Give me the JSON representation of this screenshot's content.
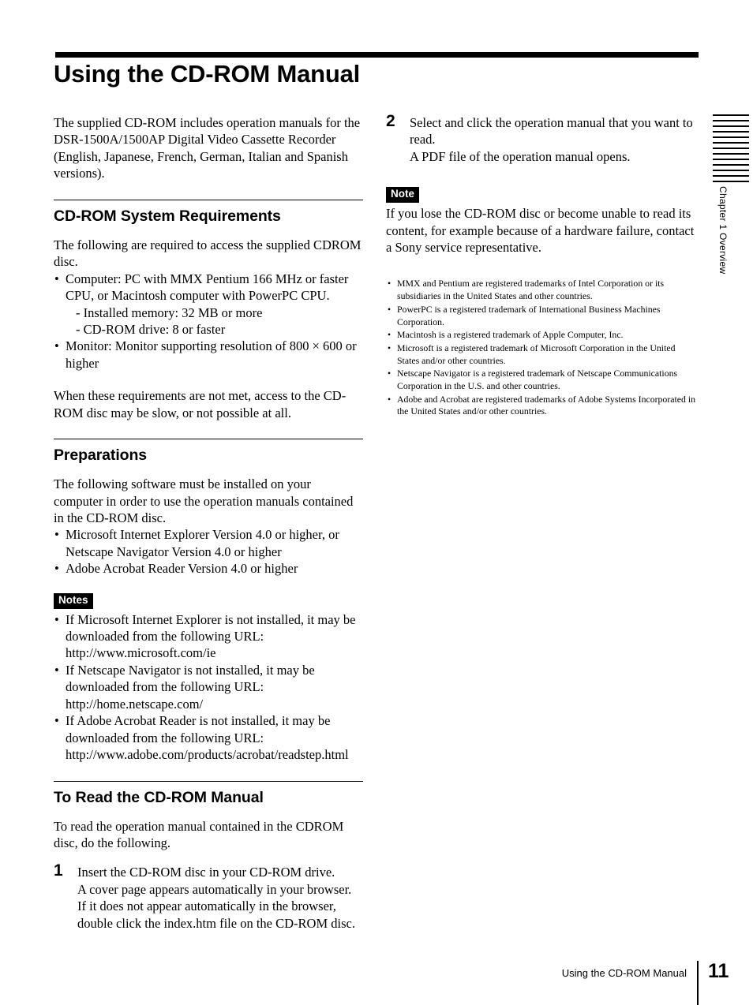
{
  "page": {
    "title": "Using the CD-ROM Manual",
    "intro": "The supplied CD-ROM includes operation manuals for the DSR-1500A/1500AP Digital Video Cassette Recorder (English, Japanese, French, German, Italian and Spanish versions).",
    "chapter_tab": "Chapter 1  Overview",
    "thumb_line_count": 13
  },
  "sections": {
    "requirements": {
      "heading": "CD-ROM System Requirements",
      "intro": "The following are required to access the supplied CDROM disc.",
      "bullets": [
        "Computer: PC with MMX Pentium 166 MHz or faster CPU, or Macintosh computer with PowerPC CPU.",
        "Monitor: Monitor supporting resolution of 800 × 600 or higher"
      ],
      "sub_items": [
        "- Installed memory: 32 MB or more",
        "- CD-ROM drive: 8 or faster"
      ],
      "closing": "When these requirements are not met, access to the CD-ROM disc may be slow, or not possible at all."
    },
    "preparations": {
      "heading": "Preparations",
      "intro": "The following software must be installed on your computer in order to use the operation manuals contained in the CD-ROM disc.",
      "bullets": [
        "Microsoft Internet Explorer Version 4.0 or higher, or Netscape Navigator Version 4.0 or higher",
        "Adobe Acrobat Reader Version 4.0 or higher"
      ],
      "notes_badge": "Notes",
      "notes": [
        "If Microsoft Internet Explorer is not installed, it may be downloaded from the following URL: http://www.microsoft.com/ie",
        "If Netscape Navigator is not installed, it may be downloaded from the following URL: http://home.netscape.com/",
        "If Adobe Acrobat Reader is not installed, it may be downloaded from the following URL: http://www.adobe.com/products/acrobat/readstep.html"
      ]
    },
    "to_read": {
      "heading": "To Read the CD-ROM Manual",
      "intro": "To read the operation manual contained in the CDROM disc, do the following.",
      "step1": {
        "number": "1",
        "text": "Insert the CD-ROM disc in your CD-ROM drive.",
        "sub": "A cover page appears automatically in your browser. If it does not appear automatically in the browser, double click the index.htm file on the CD-ROM disc."
      }
    },
    "right_column": {
      "step2": {
        "number": "2",
        "text": "Select and click the operation manual that you want to read.",
        "sub": "A PDF file of the operation manual opens."
      },
      "note_badge": "Note",
      "note_text": "If you lose the CD-ROM disc or become unable to read its content, for example because of a hardware failure, contact a Sony service representative.",
      "trademarks": [
        "MMX and Pentium are registered trademarks of Intel Corporation or its subsidiaries in the United States and other countries.",
        "PowerPC is a registered trademark of International Business Machines Corporation.",
        "Macintosh is a registered trademark of Apple Computer, Inc.",
        "Microsoft is a registered trademark of Microsoft Corporation in the United States and/or other countries.",
        "Netscape Navigator is a registered trademark of Netscape Communications Corporation in the U.S. and other countries.",
        "Adobe and Acrobat are registered trademarks of Adobe Systems Incorporated in the United States and/or other countries."
      ]
    }
  },
  "footer": {
    "running_head": "Using the CD-ROM Manual",
    "page_number": "11"
  }
}
